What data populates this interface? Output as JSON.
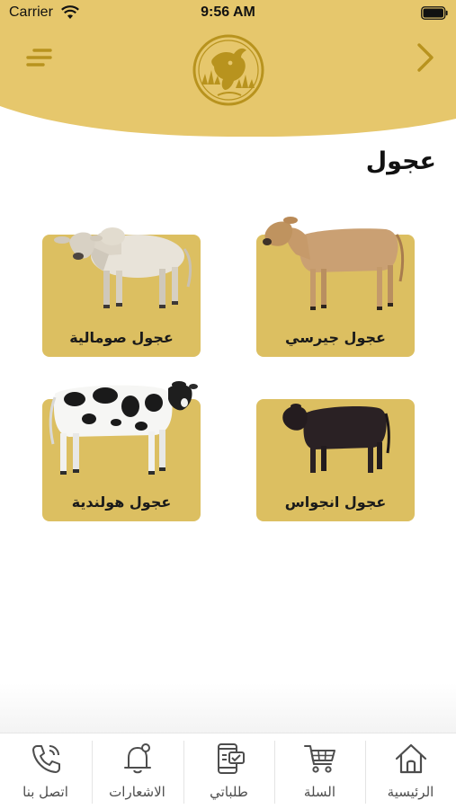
{
  "status_bar": {
    "carrier": "Carrier",
    "time": "9:56 AM"
  },
  "header": {
    "menu_icon": "menu-lines-icon",
    "forward_icon": "chevron-right-icon",
    "logo": "cow-farm-logo",
    "accent_color": "#e6c76c"
  },
  "page": {
    "title": "عجول"
  },
  "products": [
    {
      "label": "عجول صومالية",
      "image": "white-zebu-calf",
      "color": "#dcbf61"
    },
    {
      "label": "عجول جيرسي",
      "image": "jersey-calf",
      "color": "#dcbf61"
    },
    {
      "label": "عجول هولندية",
      "image": "holstein-calf",
      "color": "#dcbf61"
    },
    {
      "label": "عجول انجواس",
      "image": "angus-calf",
      "color": "#dcbf61"
    }
  ],
  "bottom_nav": {
    "items": [
      {
        "label": "اتصل بنا",
        "icon": "phone-icon"
      },
      {
        "label": "الاشعارات",
        "icon": "bell-icon"
      },
      {
        "label": "طلباتي",
        "icon": "orders-icon"
      },
      {
        "label": "السلة",
        "icon": "cart-icon"
      },
      {
        "label": "الرئيسية",
        "icon": "home-icon"
      }
    ]
  }
}
